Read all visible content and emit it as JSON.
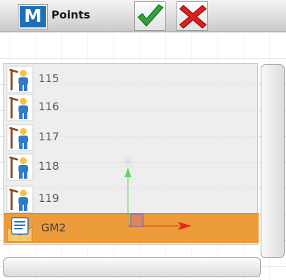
{
  "header": {
    "logo_letter": "M",
    "title": "Points",
    "ok_icon": "checkmark-icon",
    "cancel_icon": "close-icon",
    "colors": {
      "ok": "#2ea43a",
      "cancel": "#d9221f",
      "logo": "#1e6fb8"
    }
  },
  "list": {
    "items": [
      {
        "label": "115",
        "icon": "surveyor-icon"
      },
      {
        "label": "116",
        "icon": "surveyor-icon"
      },
      {
        "label": "117",
        "icon": "surveyor-icon"
      },
      {
        "label": "118",
        "icon": "surveyor-icon"
      },
      {
        "label": "119",
        "icon": "surveyor-icon"
      },
      {
        "label": "GM2",
        "icon": "note-envelope-icon",
        "selected": true
      }
    ],
    "selected_color": "#ec9c3a"
  },
  "bottom_bar": {
    "value": ""
  }
}
